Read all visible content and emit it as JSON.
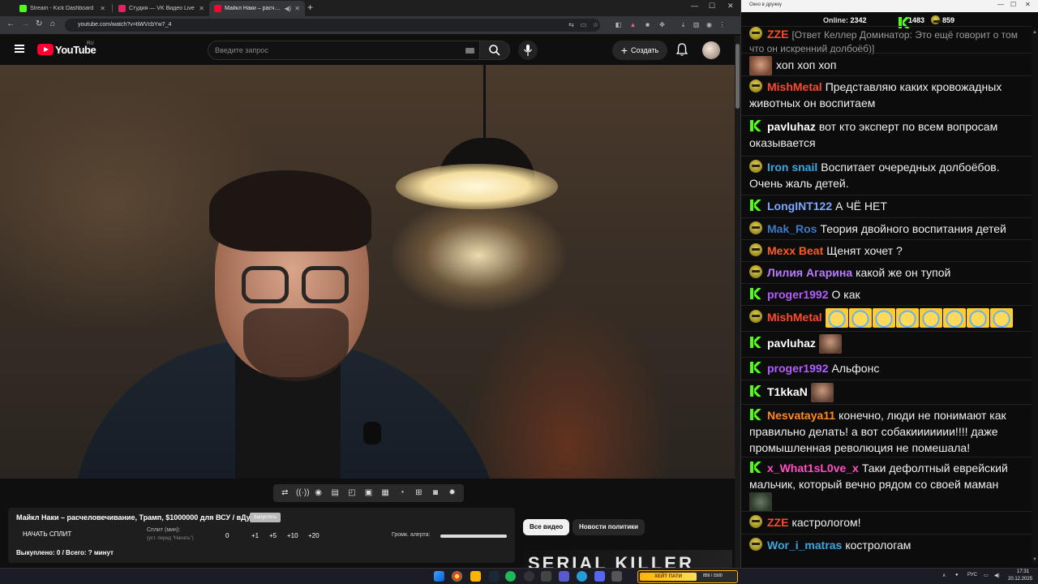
{
  "browser": {
    "tabs": [
      {
        "title": "Stream - Kick Dashboard",
        "color": "#53fc18"
      },
      {
        "title": "Студия — VK Видео Live",
        "color": "#e0245e"
      },
      {
        "title": "Майкл Наки – расчеловеч",
        "color": "#ff0033"
      }
    ],
    "url": "youtube.com/watch?v=tiWVcbYw7_4"
  },
  "youtube": {
    "logo_text": "YouTube",
    "region": "RU",
    "search_placeholder": "Введите запрос",
    "create_label": "Создать"
  },
  "player": {
    "control_icons": [
      "loop-icon",
      "broadcast-icon",
      "eye-icon",
      "clapper-icon",
      "frame-icon",
      "pip-icon",
      "filmstrip-icon",
      "speed-icon",
      "add-icon",
      "camera-icon",
      "settings-icon"
    ]
  },
  "panel": {
    "title": "Майкл Наки – расчеловечивание, Трамп, $1000000 для ВСУ / вДудь",
    "badge": "Запустить",
    "start_split": "НАЧАТЬ СПЛИТ",
    "split_label": "Сплит (мин):",
    "split_hint": "(уст. перед \"Начать\")",
    "split_values": [
      "0",
      "+1",
      "+5",
      "+10",
      "+20"
    ],
    "alert_label": "Громк. алерта:",
    "alert_volume": 1.0,
    "bought": "Выкуплено: 0 / Всего: ? минут"
  },
  "chips": {
    "all": "Все видео",
    "news": "Новости политики"
  },
  "thumb_text": "SERIAL KILLER",
  "chat": {
    "window_title": "Окно в дружку",
    "online_label": "Online:",
    "online": "2342",
    "kick_count": "1483",
    "vk_count": "859",
    "messages": [
      {
        "platform": "vk",
        "nick": "ZZE",
        "color": "#ff4a2b",
        "text": "",
        "reply": "[Ответ Келлер Доминатор: Это ещё говорит о том что он искренний долбоёб)]"
      },
      {
        "platform": "none",
        "nick": "",
        "color": "#ffffff",
        "text": "хоп хоп хоп",
        "emotes": [
          "face"
        ]
      },
      {
        "platform": "vk",
        "nick": "MishMetal",
        "color": "#ff4a2b",
        "text": "Представляю каких кровожадных животных он воспитаем"
      },
      {
        "platform": "kick",
        "nick": "pavluhaz",
        "color": "#ffffff",
        "text": "вот кто эксперт по всем вопросам оказывается"
      },
      {
        "platform": "vk",
        "nick": "Iron snail",
        "color": "#3aa7e0",
        "text": "Воспитает очередных долбоёбов. Очень жаль детей."
      },
      {
        "platform": "kick",
        "nick": "LongINT122",
        "color": "#7aa8ff",
        "text": "А ЧЁ НЕТ"
      },
      {
        "platform": "vk",
        "nick": "Mak_Ros",
        "color": "#3a7ac9",
        "text": "Теория двойного воспитания детей"
      },
      {
        "platform": "vk",
        "nick": "Mexx Beat",
        "color": "#ff5a1f",
        "text": "Щенят хочет ?"
      },
      {
        "platform": "vk",
        "nick": "Лилия Агарина",
        "color": "#b87bff",
        "text": "какой же он тупой"
      },
      {
        "platform": "kick",
        "nick": "proger1992",
        "color": "#b35cff",
        "text": "О как"
      },
      {
        "platform": "vk",
        "nick": "MishMetal",
        "color": "#ff4a2b",
        "text": "",
        "emotes": [
          "laugh",
          "laugh",
          "laugh",
          "laugh",
          "laugh",
          "laugh",
          "laugh",
          "laugh"
        ]
      },
      {
        "platform": "kick",
        "nick": "pavluhaz",
        "color": "#ffffff",
        "text": "",
        "emotes": [
          "man"
        ]
      },
      {
        "platform": "kick",
        "nick": "proger1992",
        "color": "#b35cff",
        "text": "Альфонс"
      },
      {
        "platform": "kick",
        "nick": "T1kkaN",
        "color": "#ffffff",
        "text": "",
        "emotes": [
          "man"
        ]
      },
      {
        "platform": "kick",
        "nick": "Nesvataya11",
        "color": "#ff8a1f",
        "text": "конечно, люди не понимают как правильно делать! а вот собакиииииии!!!! даже промышленная революция не помешала!"
      },
      {
        "platform": "kick",
        "nick": "x_What1sL0ve_x",
        "color": "#ff4fc3",
        "text": "Таки дефолтный еврейский мальчик, который вечно рядом со своей маман",
        "emotes_after": [
          "cat"
        ]
      },
      {
        "platform": "vk",
        "nick": "ZZE",
        "color": "#ff4a2b",
        "text": "кастрологом!"
      },
      {
        "platform": "vk",
        "nick": "Wor_i_matras",
        "color": "#3aa7e0",
        "text": "кострологам"
      }
    ]
  },
  "taskbar": {
    "widget_label": "ХЕЙТ ПАТИ",
    "widget_value": "859 / 1500",
    "lang": "РУС",
    "time": "17:31",
    "date": "20.12.2025"
  }
}
